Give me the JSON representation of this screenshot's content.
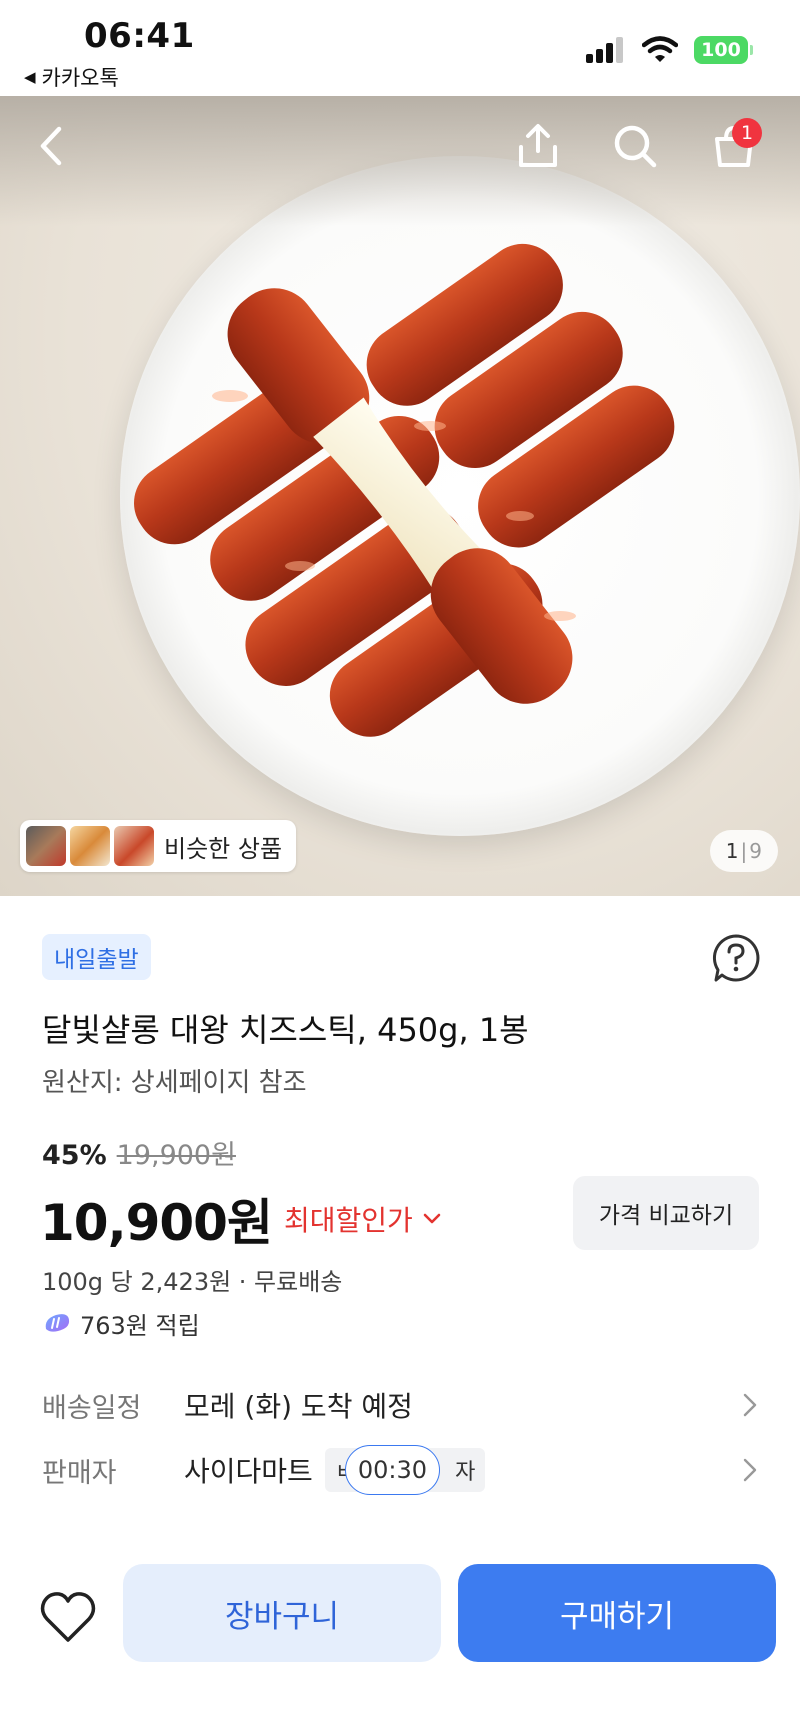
{
  "status_bar": {
    "time": "06:41",
    "back_app": "카카오톡",
    "battery": "100"
  },
  "header": {
    "cart_badge": "1"
  },
  "hero": {
    "similar_label": "비슷한 상품",
    "page_current": "1",
    "page_total": "9"
  },
  "product": {
    "tag": "내일출발",
    "title": "달빛샬롱 대왕 치즈스틱, 450g, 1봉",
    "origin": "원산지: 상세페이지 참조",
    "discount": "45%",
    "original_price": "19,900원",
    "price": "10,900원",
    "best_price_label": "최대할인가",
    "compare_label": "가격 비교하기",
    "unit_price": "100g 당 2,423원 · 무료배송",
    "points": "763원 적립"
  },
  "info": {
    "delivery_label": "배송일정",
    "delivery_value": "모레 (화) 도착 예정",
    "seller_label": "판매자",
    "seller_value": "사이다마트",
    "seller_chip_left": "ㅂ",
    "seller_chip_right": "자",
    "timer": "00:30"
  },
  "bottom": {
    "cart_label": "장바구니",
    "buy_label": "구매하기"
  },
  "colors": {
    "accent": "#3d7cf0",
    "sale_red": "#e3332f",
    "badge_red": "#f0343f",
    "tag_blue": "#2f6fe4"
  }
}
